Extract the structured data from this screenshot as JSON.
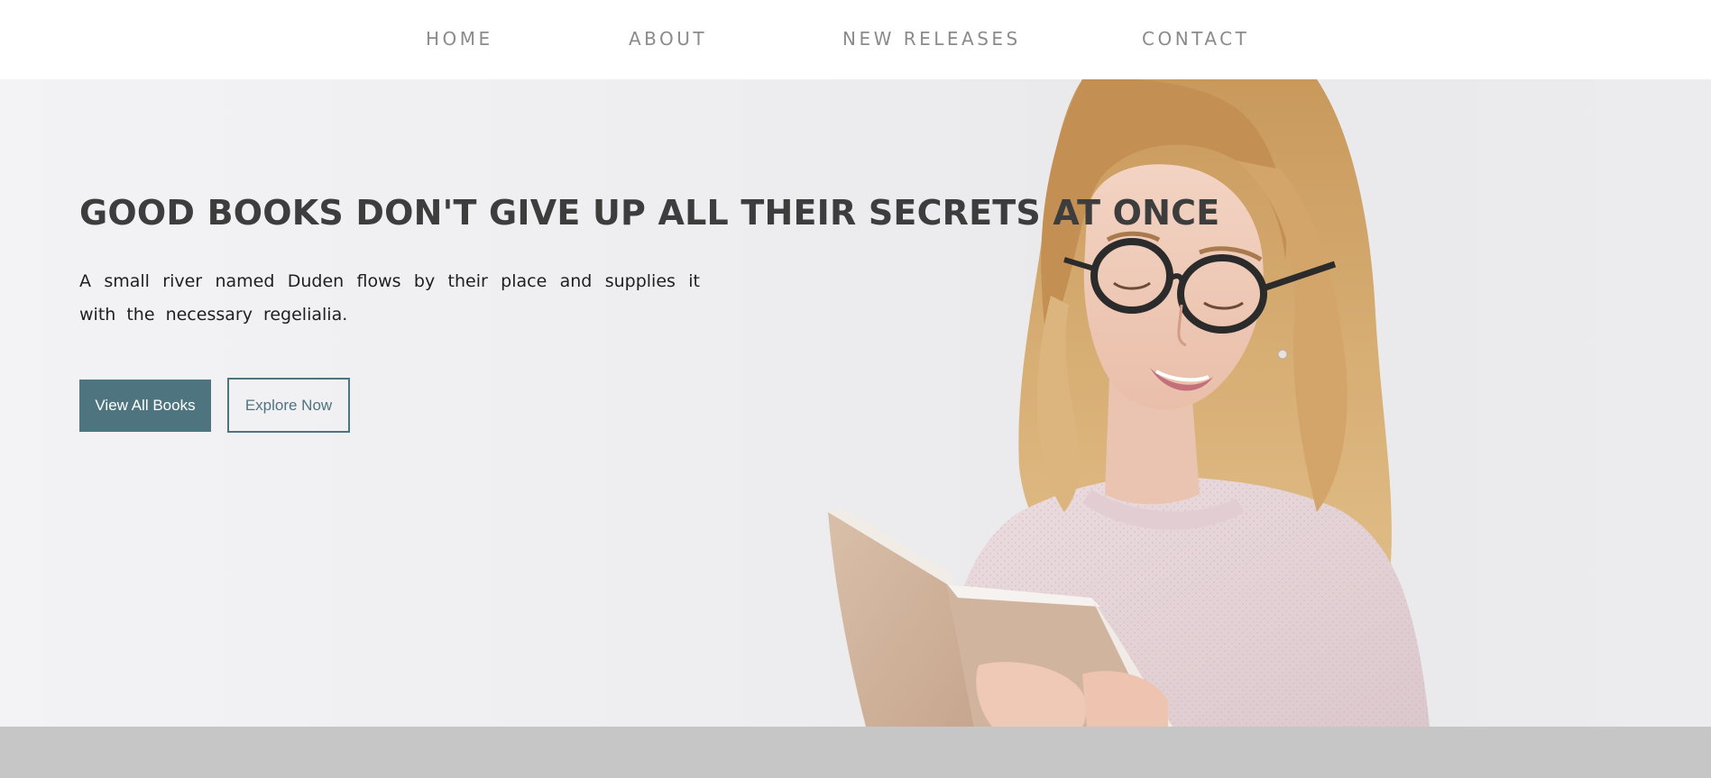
{
  "nav": {
    "items": [
      {
        "label": "HOME"
      },
      {
        "label": "ABOUT"
      },
      {
        "label": "NEW RELEASES"
      },
      {
        "label": "CONTACT"
      }
    ]
  },
  "hero": {
    "title": "GOOD BOOKS DON'T GIVE UP ALL THEIR SECRETS AT ONCE",
    "text": "A small river named Duden flows by their place and supplies it with the necessary regelialia.",
    "primary_button": "View All Books",
    "secondary_button": "Explore Now"
  },
  "colors": {
    "accent": "#4e7480",
    "nav_text": "#8b8b8b",
    "title": "#3d3d3d",
    "footer": "#c6c6c6"
  }
}
